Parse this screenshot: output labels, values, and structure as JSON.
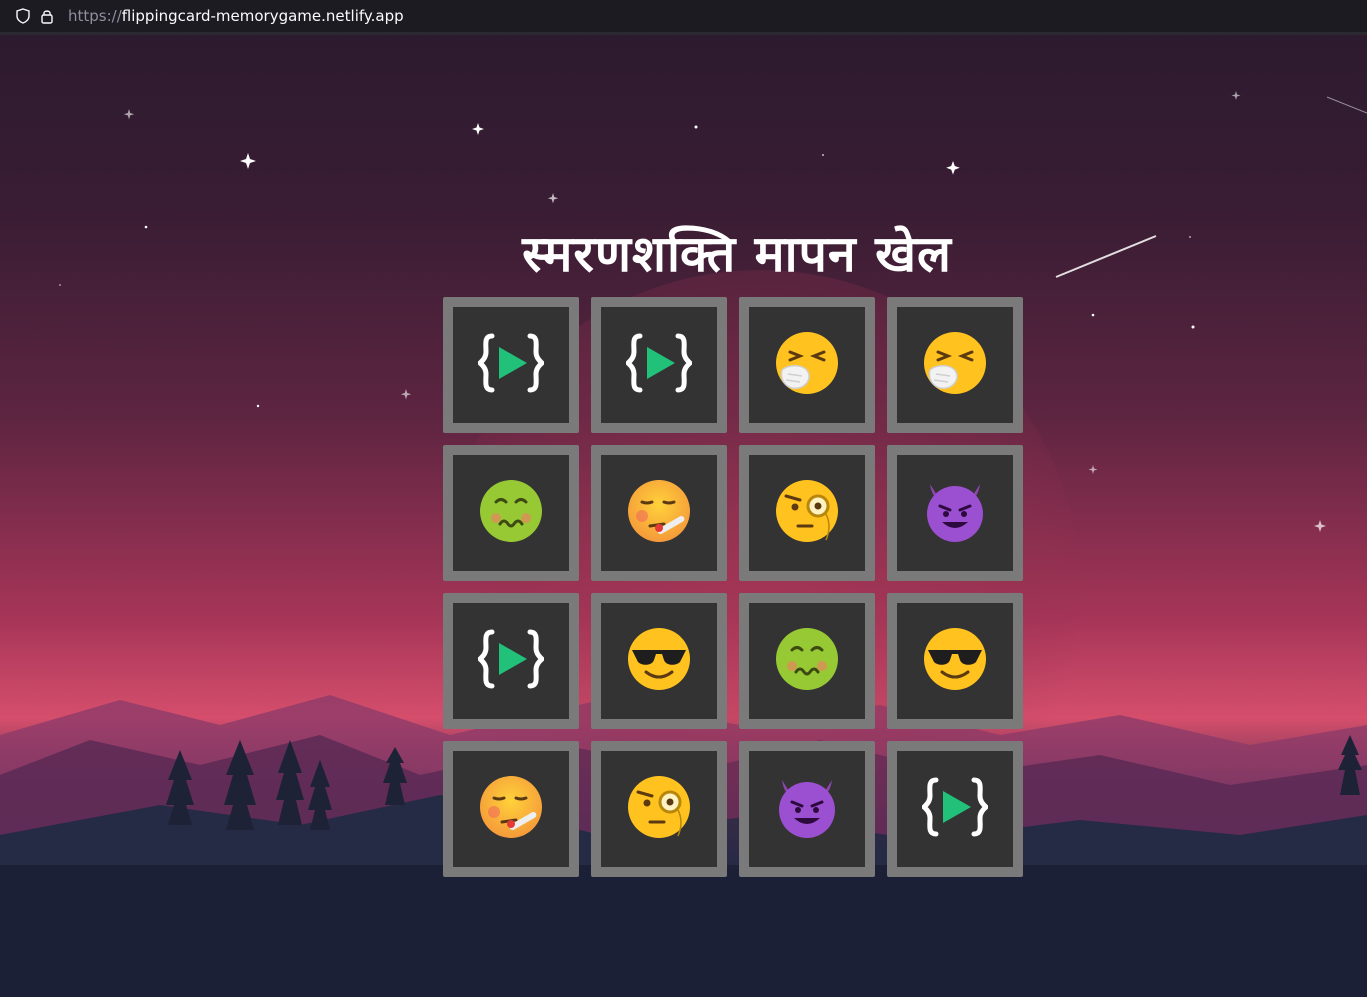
{
  "browser": {
    "url_scheme": "https://",
    "url_host": "flippingcard-memorygame.netlify.app"
  },
  "page": {
    "title": "स्मरणशक्ति मापन खेल"
  },
  "cards": [
    {
      "icon": "code-play-icon"
    },
    {
      "icon": "code-play-icon"
    },
    {
      "icon": "sneezing-face-icon"
    },
    {
      "icon": "sneezing-face-icon"
    },
    {
      "icon": "nauseated-face-icon"
    },
    {
      "icon": "thermometer-face-icon"
    },
    {
      "icon": "monocle-face-icon"
    },
    {
      "icon": "smiling-devil-icon"
    },
    {
      "icon": "code-play-icon"
    },
    {
      "icon": "sunglasses-face-icon"
    },
    {
      "icon": "nauseated-face-icon"
    },
    {
      "icon": "sunglasses-face-icon"
    },
    {
      "icon": "thermometer-face-icon"
    },
    {
      "icon": "monocle-face-icon"
    },
    {
      "icon": "smiling-devil-icon"
    },
    {
      "icon": "code-play-icon"
    }
  ],
  "colors": {
    "card_border": "#7a7a7a",
    "card_face": "#333333",
    "play_green": "#21c17a"
  }
}
